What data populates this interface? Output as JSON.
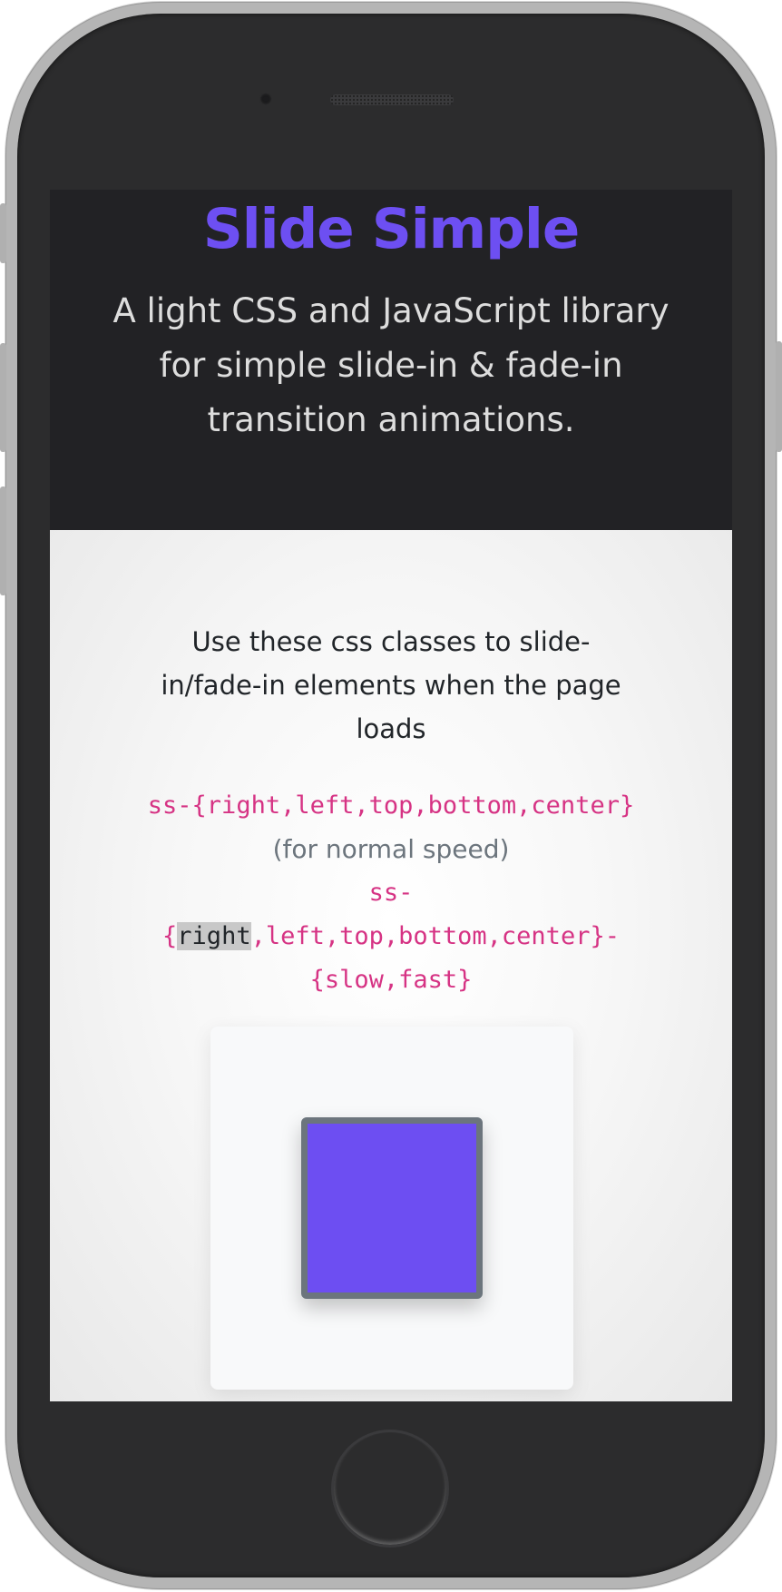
{
  "hero": {
    "title": "Slide Simple",
    "subtitle": "A light CSS and JavaScript library for simple slide-in & fade-in transition animations."
  },
  "content": {
    "lead": "Use these css classes to slide-in/fade-in elements when the page loads",
    "normal_class": "ss-{right,left,top,bottom,center}",
    "normal_note": "(for normal speed)",
    "speed_class_prefix_1": "ss-",
    "speed_class_prefix_2": "{",
    "speed_class_selected": "right",
    "speed_class_rest": ",left,top,bottom,center}-",
    "speed_class_suffix": "{slow,fast}"
  },
  "colors": {
    "accent": "#6d4ff2",
    "code": "#d63384",
    "hero_bg": "#222225",
    "box_border": "#6c757d"
  }
}
